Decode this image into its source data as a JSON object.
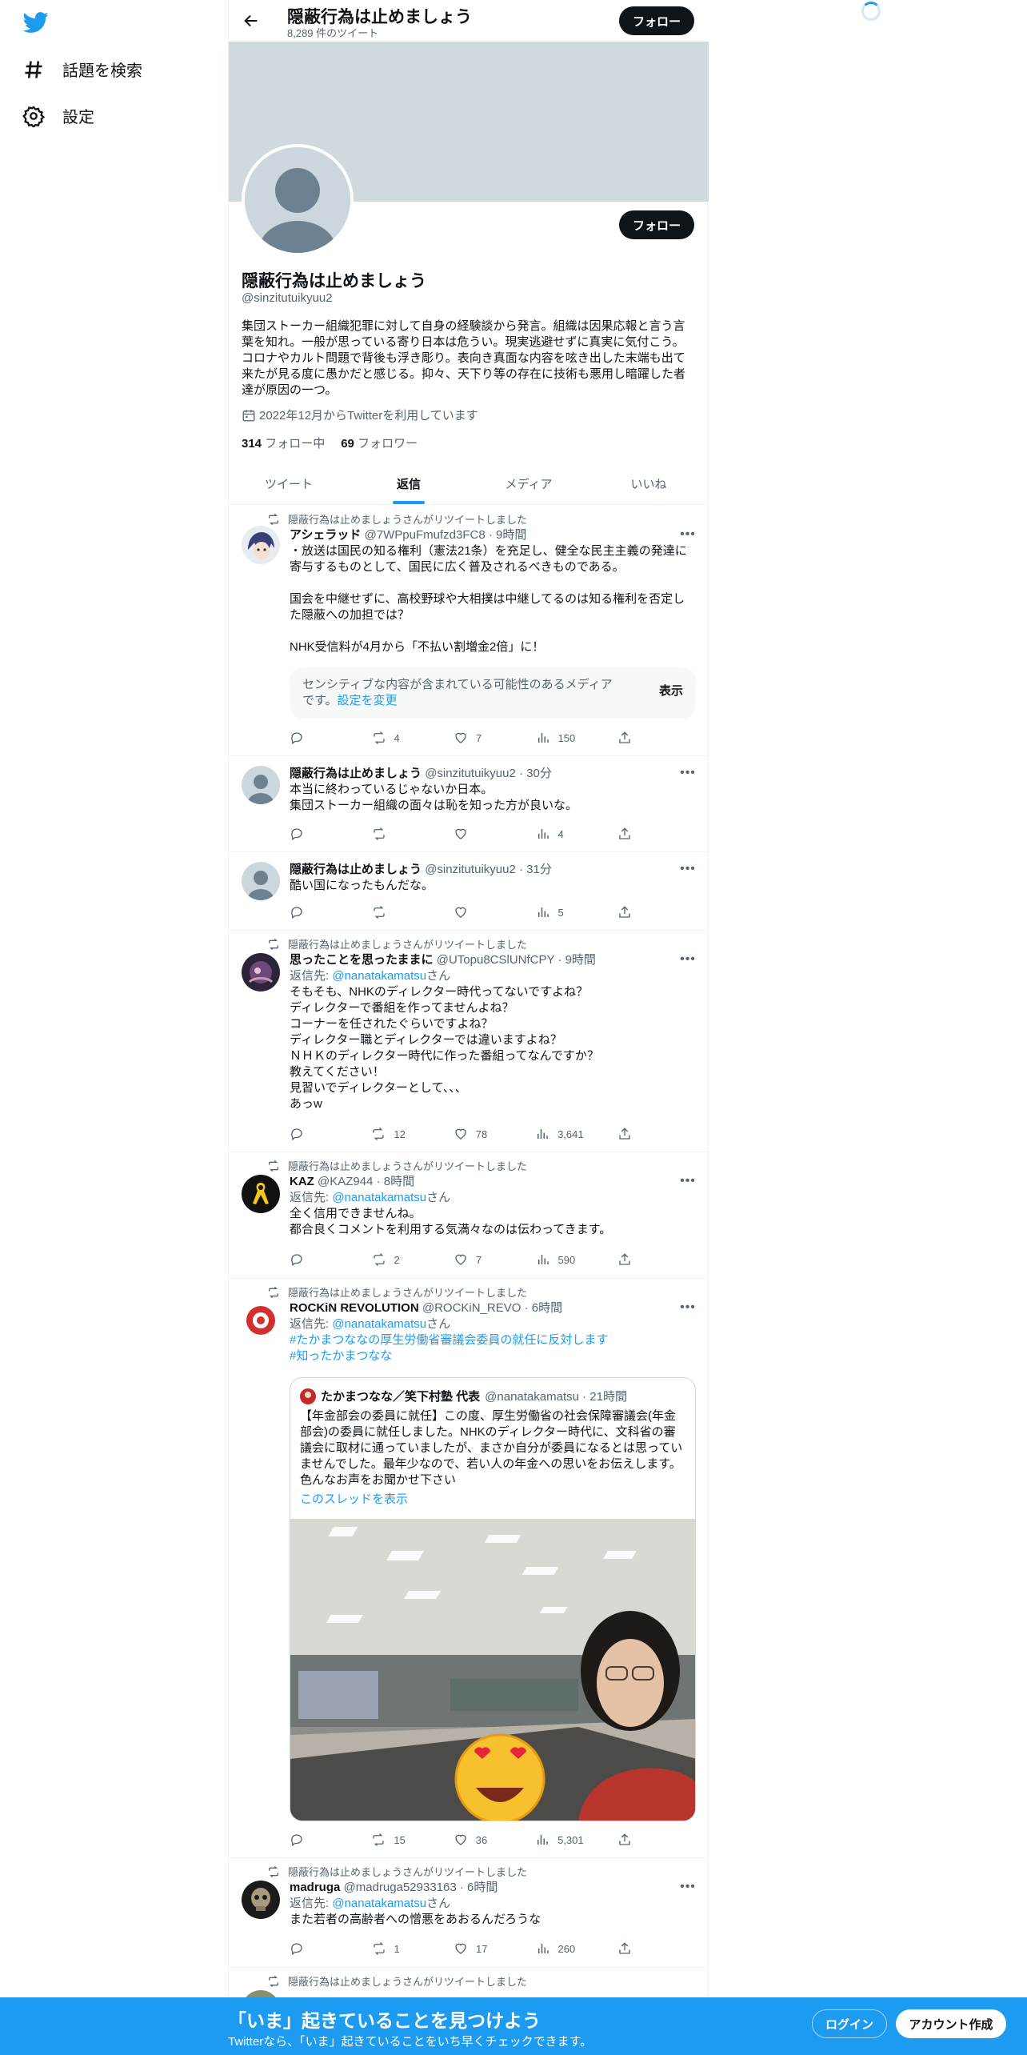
{
  "nav": {
    "explore_label": "話題を検索",
    "settings_label": "設定"
  },
  "header": {
    "name": "隠蔽行為は止めましょう",
    "tweet_count": "8,289 件のツイート",
    "follow_label": "フォロー"
  },
  "profile": {
    "name": "隠蔽行為は止めましょう",
    "handle": "@sinzitutuikyuu2",
    "bio": "集団ストーカー組織犯罪に対して自身の経験談から発言。組織は因果応報と言う言葉を知れ。一般が思っている寄り日本は危うい。現実逃避せずに真実に気付こう。コロナやカルト問題で背後も浮き彫り。表向き真面な内容を呟き出した末端も出て来たが見る度に愚かだと感じる。抑々、天下り等の存在に技術も悪用し暗躍した者達が原因の一つ。",
    "joined": "2022年12月からTwitterを利用しています",
    "following_count": "314",
    "following_label": "フォロー中",
    "followers_count": "69",
    "followers_label": "フォロワー",
    "follow_label": "フォロー"
  },
  "tabs": [
    "ツイート",
    "返信",
    "メディア",
    "いいね"
  ],
  "tweets": [
    {
      "retweet_note": "隠蔽行為は止めましょうさんがリツイートしました",
      "name": "アシェラッド",
      "meta": "@7WPpuFmufzd3FC8 · 9時間",
      "text": "・放送は国民の知る権利（憲法21条）を充足し、健全な民主主義の発達に寄与するものとして、国民に広く普及されるべきものである。\n\n国会を中継せずに、高校野球や大相撲は中継してるのは知る権利を否定した隠蔽への加担では？\n\nNHK受信料が4月から「不払い割増金2倍」に！",
      "sensitive_text": "センシティブな内容が含まれている可能性のあるメディアです。",
      "sensitive_link": "設定を変更",
      "show_label": "表示",
      "retweets": "4",
      "likes": "7",
      "views": "150"
    },
    {
      "name": "隠蔽行為は止めましょう",
      "meta": "@sinzitutuikyuu2 · 30分",
      "text": "本当に終わっているじゃないか日本。\n集団ストーカー組織の面々は恥を知った方が良いな。",
      "retweets": "",
      "likes": "",
      "views": "4"
    },
    {
      "name": "隠蔽行為は止めましょう",
      "meta": "@sinzitutuikyuu2 · 31分",
      "text": "酷い国になったもんだな。",
      "retweets": "",
      "likes": "",
      "views": "5"
    },
    {
      "retweet_note": "隠蔽行為は止めましょうさんがリツイートしました",
      "name": "思ったことを思ったままに",
      "meta": "@UTopu8CSlUNfCPY · 9時間",
      "reply_prefix": "返信先: ",
      "reply_handle": "@nanatakamatsu",
      "reply_suffix": "さん",
      "text": "そもそも、NHKのディレクター時代ってないですよね？\nディレクターで番組を作ってませんよね？\nコーナーを任されたぐらいですよね？\nディレクター職とディレクターでは違いますよね？\nＮＨＫのディレクター時代に作った番組ってなんですか？\n教えてください！\n見習いでディレクターとして、、、\nあっw",
      "retweets": "12",
      "likes": "78",
      "views": "3,641"
    },
    {
      "retweet_note": "隠蔽行為は止めましょうさんがリツイートしました",
      "name": "KAZ",
      "meta": "@KAZ944 · 8時間",
      "reply_prefix": "返信先: ",
      "reply_handle": "@nanatakamatsu",
      "reply_suffix": "さん",
      "text": "全く信用できませんね。\n都合良くコメントを利用する気満々なのは伝わってきます。",
      "retweets": "2",
      "likes": "7",
      "views": "590"
    },
    {
      "retweet_note": "隠蔽行為は止めましょうさんがリツイートしました",
      "name": "ROCKiN REVOLUTION",
      "meta": "@ROCKiN_REVO · 6時間",
      "reply_prefix": "返信先: ",
      "reply_handle": "@nanatakamatsu",
      "reply_suffix": "さん",
      "hashtag1": "#たかまつななの厚生労働省審議会委員の就任に反対します",
      "hashtag2": "#知ったかまつなな",
      "quote_name": "たかまつなな／笑下村塾 代表",
      "quote_meta": "@nanatakamatsu · 21時間",
      "quote_text": "【年金部会の委員に就任】この度、厚生労働省の社会保障審議会(年金部会)の委員に就任しました。NHKのディレクター時代に、文科省の審議会に取材に通っていましたが、まさか自分が委員になるとは思っていませんでした。最年少なので、若い人の年金への思いをお伝えします。色んなお声をお聞かせ下さい",
      "quote_thread": "このスレッドを表示",
      "retweets": "15",
      "likes": "36",
      "views": "5,301"
    },
    {
      "retweet_note": "隠蔽行為は止めましょうさんがリツイートしました",
      "name": "madruga",
      "meta": "@madruga52933163 · 6時間",
      "reply_prefix": "返信先: ",
      "reply_handle": "@nanatakamatsu",
      "reply_suffix": "さん",
      "text": "また若者の高齢者への憎悪をあおるんだろうな",
      "retweets": "1",
      "likes": "17",
      "views": "260"
    },
    {
      "retweet_note": "隠蔽行為は止めましょうさんがリツイートしました"
    }
  ],
  "bottombar": {
    "title": "「いま」起きていることを見つけよう",
    "subtitle": "Twitterなら、「いま」起きていることをいち早くチェックできます。",
    "login_label": "ログイン",
    "signup_label": "アカウント作成"
  },
  "colors": {
    "accent": "#1d9bf0",
    "text": "#0f1419",
    "muted": "#536471"
  }
}
